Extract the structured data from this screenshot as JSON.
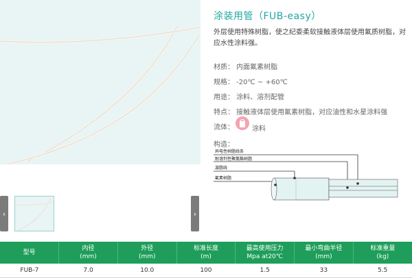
{
  "product": {
    "title": "涂装用管（FUB-easy）",
    "description": "外层使用特殊树脂，使之纪委柔软接触液体层使用氟质树脂，对应水性涂料强。"
  },
  "gallery": {
    "prev_icon": "chevron-left-icon",
    "next_icon": "chevron-right-icon",
    "prev_glyph": "‹",
    "next_glyph": "›"
  },
  "specs": {
    "material": "材质：  内面氟素树脂",
    "range": "规格：  -20℃ ~ +60℃",
    "usage": "用途：  涂料、溶剂配管",
    "feature": "特点：  接触液体层使用氟素树脂，对应油性和水星涂料强",
    "fluid_label": "流体：",
    "fluid_value": "涂料",
    "fluid_icon": "paint-drop-icon",
    "structure_label": "构造："
  },
  "diagram": {
    "labels": [
      "异电性树脂线条",
      "耐溶剂性聚氨酯树脂",
      "漩脂线",
      "氟素树脂"
    ]
  },
  "table": {
    "headers": [
      [
        "型号"
      ],
      [
        "内径",
        "(mm)"
      ],
      [
        "外径",
        "(mm)"
      ],
      [
        "标准长度",
        "(m)"
      ],
      [
        "最高使用压力",
        "Mpa at20℃"
      ],
      [
        "最小弯曲半径",
        "(mm)"
      ],
      [
        "标准重量",
        "(kg)"
      ]
    ],
    "rows": [
      [
        "FUB-7",
        "7.0",
        "10.0",
        "100",
        "1.5",
        "33",
        "5.5"
      ]
    ]
  },
  "colors": {
    "accent": "#1fa7a2",
    "table_header": "#1e9e5a",
    "image_bg": "#e9f4f4"
  }
}
